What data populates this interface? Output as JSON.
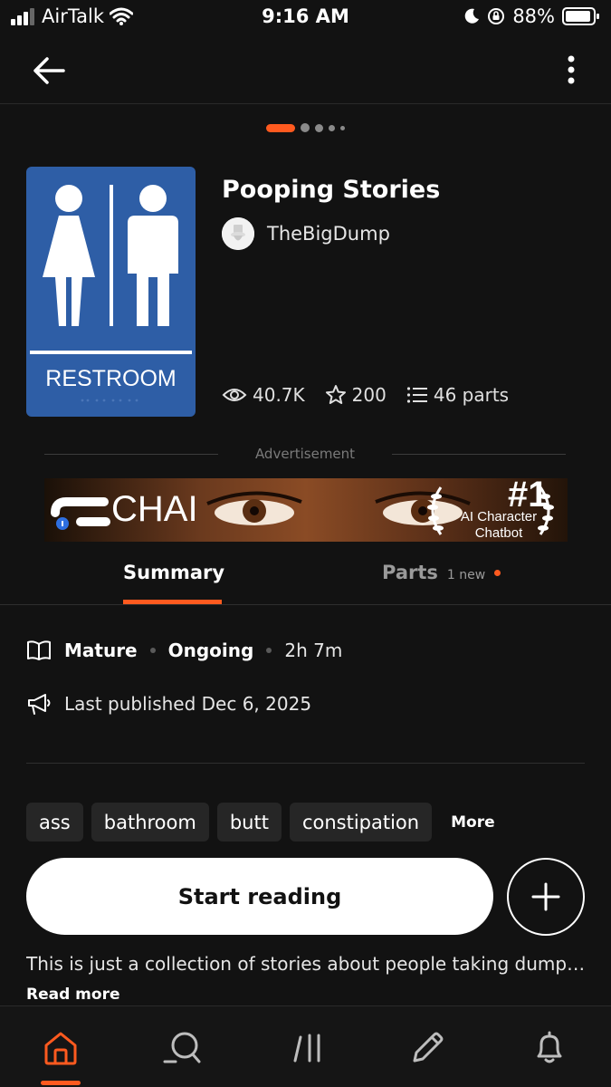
{
  "status_bar": {
    "carrier": "AirTalk",
    "time": "9:16 AM",
    "battery": "88%"
  },
  "story": {
    "title": "Pooping Stories",
    "author": "TheBigDump",
    "cover_text": "RESTROOM",
    "views": "40.7K",
    "votes": "200",
    "parts": "46 parts"
  },
  "ad": {
    "label": "Advertisement",
    "brand": "CHAI",
    "rank": "#1",
    "tagline_line1": "AI Character",
    "tagline_line2": "Chatbot"
  },
  "tabs": {
    "summary": "Summary",
    "parts": "Parts",
    "parts_badge": "1 new"
  },
  "meta": {
    "rating": "Mature",
    "status": "Ongoing",
    "reading_time": "2h 7m",
    "last_published": "Last published Dec 6, 2025"
  },
  "tags": [
    "ass",
    "bathroom",
    "butt",
    "constipation"
  ],
  "tags_more": "More",
  "actions": {
    "start_reading": "Start reading"
  },
  "description": "This is just a collection of stories about people taking dumps…",
  "read_more": "Read more",
  "colors": {
    "accent": "#ff5a1f",
    "background": "#121212",
    "cover": "#2e5ea6"
  },
  "nav": [
    "home-icon",
    "search-icon",
    "library-icon",
    "write-icon",
    "notifications-icon"
  ]
}
